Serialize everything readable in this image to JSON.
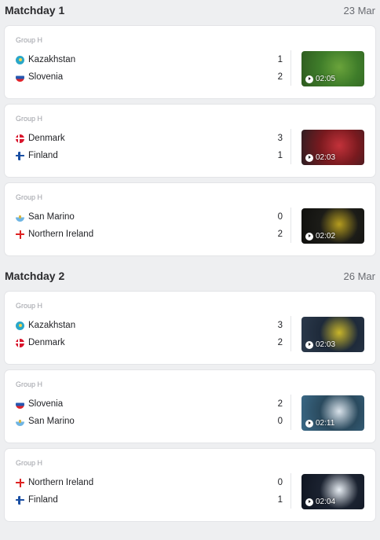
{
  "matchdays": [
    {
      "title": "Matchday 1",
      "date": "23 Mar",
      "matches": [
        {
          "group": "Group H",
          "home": {
            "name": "Kazakhstan",
            "score": "1",
            "flag": "kazakhstan-flag-icon"
          },
          "away": {
            "name": "Slovenia",
            "score": "2",
            "flag": "slovenia-flag-icon"
          },
          "duration": "02:05",
          "thumb_colors": [
            "#3f7d2a",
            "#6aa33b",
            "#2d5a1f"
          ]
        },
        {
          "group": "Group H",
          "home": {
            "name": "Denmark",
            "score": "3",
            "flag": "denmark-flag-icon"
          },
          "away": {
            "name": "Finland",
            "score": "1",
            "flag": "finland-flag-icon"
          },
          "duration": "02:03",
          "thumb_colors": [
            "#7a1a1f",
            "#c3323a",
            "#2a1e22"
          ]
        },
        {
          "group": "Group H",
          "home": {
            "name": "San Marino",
            "score": "0",
            "flag": "san-marino-flag-icon"
          },
          "away": {
            "name": "Northern Ireland",
            "score": "2",
            "flag": "northern-ireland-flag-icon"
          },
          "duration": "02:02",
          "thumb_colors": [
            "#1c1c18",
            "#b59c1e",
            "#0f0f0d"
          ]
        }
      ]
    },
    {
      "title": "Matchday 2",
      "date": "26 Mar",
      "matches": [
        {
          "group": "Group H",
          "home": {
            "name": "Kazakhstan",
            "score": "3",
            "flag": "kazakhstan-flag-icon"
          },
          "away": {
            "name": "Denmark",
            "score": "2",
            "flag": "denmark-flag-icon"
          },
          "duration": "02:03",
          "thumb_colors": [
            "#1e2a3a",
            "#c8b52a",
            "#2c3a4c"
          ]
        },
        {
          "group": "Group H",
          "home": {
            "name": "Slovenia",
            "score": "2",
            "flag": "slovenia-flag-icon"
          },
          "away": {
            "name": "San Marino",
            "score": "0",
            "flag": "san-marino-flag-icon"
          },
          "duration": "02:11",
          "thumb_colors": [
            "#2a4a5e",
            "#d9e2ea",
            "#3b6a88"
          ]
        },
        {
          "group": "Group H",
          "home": {
            "name": "Northern Ireland",
            "score": "0",
            "flag": "northern-ireland-flag-icon"
          },
          "away": {
            "name": "Finland",
            "score": "1",
            "flag": "finland-flag-icon"
          },
          "duration": "02:04",
          "thumb_colors": [
            "#1b2230",
            "#e8eef4",
            "#0e1420"
          ]
        }
      ]
    }
  ]
}
